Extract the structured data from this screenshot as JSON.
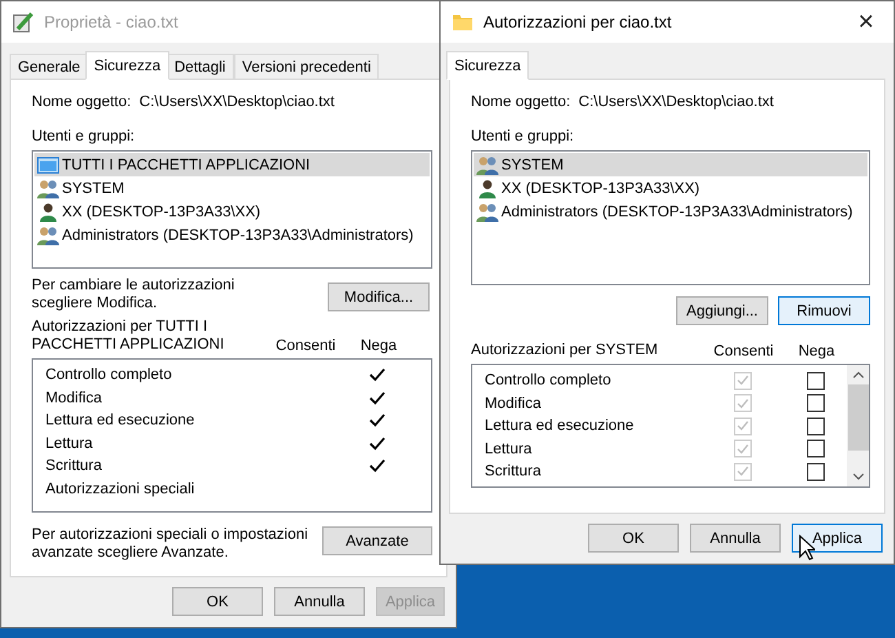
{
  "properties_window": {
    "title": "Proprietà - ciao.txt",
    "active": false,
    "tabs": [
      {
        "label": "Generale",
        "selected": false
      },
      {
        "label": "Sicurezza",
        "selected": true
      },
      {
        "label": "Dettagli",
        "selected": false
      },
      {
        "label": "Versioni precedenti",
        "selected": false
      }
    ],
    "object_name_label": "Nome oggetto:",
    "object_name": "C:\\Users\\XX\\Desktop\\ciao.txt",
    "users_label": "Utenti e gruppi:",
    "users": [
      {
        "name": "TUTTI I PACCHETTI APPLICAZIONI",
        "kind": "package",
        "selected": true
      },
      {
        "name": "SYSTEM",
        "kind": "group",
        "selected": false
      },
      {
        "name": "XX (DESKTOP-13P3A33\\XX)",
        "kind": "user",
        "selected": false
      },
      {
        "name": "Administrators (DESKTOP-13P3A33\\Administrators)",
        "kind": "group",
        "selected": false
      }
    ],
    "edit_hint": "Per cambiare le autorizzazioni\nscegliere Modifica.",
    "edit_button": "Modifica...",
    "permissions_label": "Autorizzazioni per TUTTI I\nPACCHETTI APPLICAZIONI",
    "allow_header": "Consenti",
    "deny_header": "Nega",
    "permissions": [
      {
        "name": "Controllo completo",
        "kind": "tick",
        "deny": true
      },
      {
        "name": "Modifica",
        "kind": "tick",
        "deny": true
      },
      {
        "name": "Lettura ed esecuzione",
        "kind": "tick",
        "deny": true
      },
      {
        "name": "Lettura",
        "kind": "tick",
        "deny": true
      },
      {
        "name": "Scrittura",
        "kind": "tick",
        "deny": true
      },
      {
        "name": "Autorizzazioni speciali",
        "kind": "tick",
        "deny": false
      }
    ],
    "advanced_hint": "Per autorizzazioni speciali o impostazioni\navanzate scegliere Avanzate.",
    "advanced_button": "Avanzate",
    "buttons": [
      {
        "label": "OK",
        "disabled": false,
        "focused": false
      },
      {
        "label": "Annulla",
        "disabled": false,
        "focused": false
      },
      {
        "label": "Applica",
        "disabled": true,
        "focused": false
      }
    ]
  },
  "permissions_window": {
    "title": "Autorizzazioni per ciao.txt",
    "active": true,
    "close": "×",
    "tabs": [
      {
        "label": "Sicurezza",
        "selected": true
      }
    ],
    "object_name_label": "Nome oggetto:",
    "object_name": "C:\\Users\\XX\\Desktop\\ciao.txt",
    "users_label": "Utenti e gruppi:",
    "users": [
      {
        "name": "SYSTEM",
        "kind": "group",
        "selected": true
      },
      {
        "name": "XX (DESKTOP-13P3A33\\XX)",
        "kind": "user",
        "selected": false
      },
      {
        "name": "Administrators (DESKTOP-13P3A33\\Administrators)",
        "kind": "group",
        "selected": false
      }
    ],
    "action_buttons": [
      {
        "label": "Aggiungi...",
        "focused": false
      },
      {
        "label": "Rimuovi",
        "focused": true
      }
    ],
    "permissions_label": "Autorizzazioni per SYSTEM",
    "allow_header": "Consenti",
    "deny_header": "Nega",
    "permissions": [
      {
        "name": "Controllo completo",
        "kind": "checkbox",
        "allow": true,
        "deny": false,
        "allow_disabled": true
      },
      {
        "name": "Modifica",
        "kind": "checkbox",
        "allow": true,
        "deny": false,
        "allow_disabled": true
      },
      {
        "name": "Lettura ed esecuzione",
        "kind": "checkbox",
        "allow": true,
        "deny": false,
        "allow_disabled": true
      },
      {
        "name": "Lettura",
        "kind": "checkbox",
        "allow": true,
        "deny": false,
        "allow_disabled": true
      },
      {
        "name": "Scrittura",
        "kind": "checkbox",
        "allow": true,
        "deny": false,
        "allow_disabled": true
      }
    ],
    "buttons": [
      {
        "label": "OK",
        "disabled": false,
        "focused": false
      },
      {
        "label": "Annulla",
        "disabled": false,
        "focused": false
      },
      {
        "label": "Applica",
        "disabled": false,
        "focused": true
      }
    ]
  }
}
